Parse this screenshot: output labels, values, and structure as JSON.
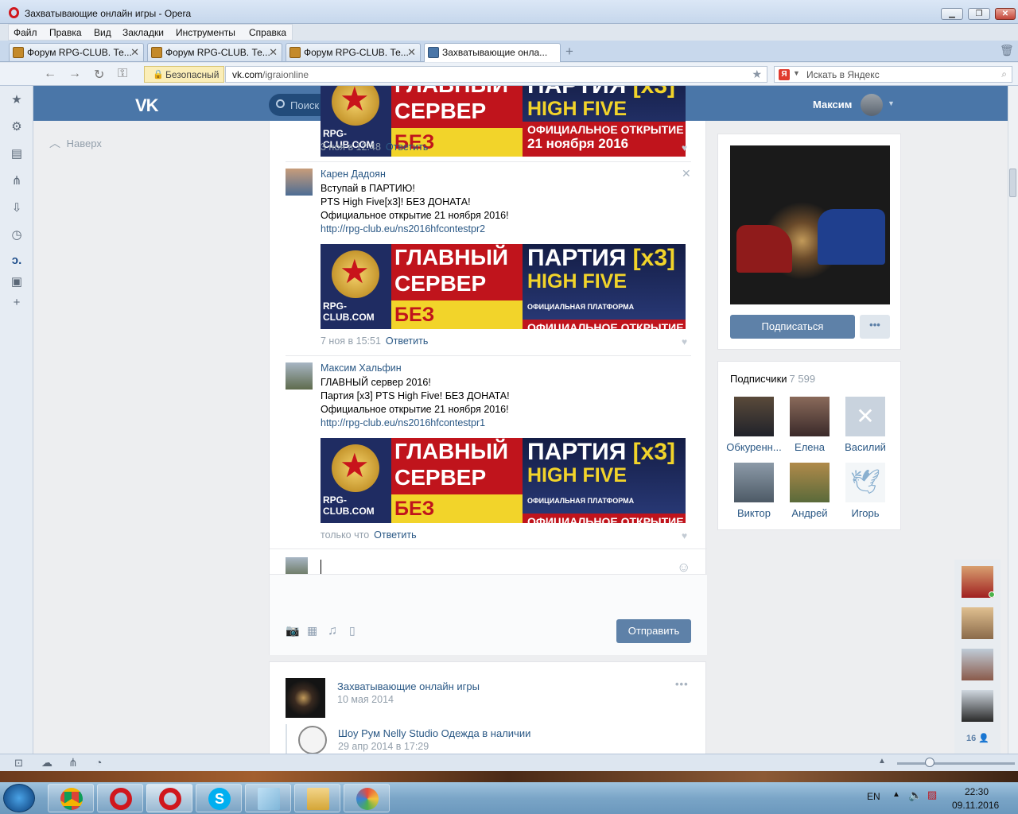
{
  "window": {
    "title": "Захватывающие онлайн игры - Opera"
  },
  "menu": [
    "Файл",
    "Правка",
    "Вид",
    "Закладки",
    "Инструменты",
    "Справка"
  ],
  "tabs": [
    {
      "label": "Форум RPG-CLUB. Те...",
      "active": false
    },
    {
      "label": "Форум RPG-CLUB. Те...",
      "active": false
    },
    {
      "label": "Форум RPG-CLUB. Те...",
      "active": false
    },
    {
      "label": "Захватывающие онла...",
      "active": true
    }
  ],
  "address": {
    "secure_label": "Безопасный",
    "url_host": "vk.com",
    "url_path": "/igraionline",
    "search_placeholder": "Искать в Яндекс"
  },
  "vk": {
    "search_placeholder": "Поиск",
    "user_name": "Максим",
    "scroll_up": "Наверх"
  },
  "banner": {
    "logo_text": "RPG-CLUB.COM",
    "line1": "ГЛАВНЫЙ",
    "line2": "СЕРВЕР",
    "line3": "БЕЗ ДОНАТА",
    "party": "ПАРТИЯ",
    "x3": "[x3]",
    "high_five": "HIGH FIVE",
    "official_platform": "ОФИЦИАЛЬНАЯ ПЛАТФОРМА",
    "opening": "ОФИЦИАЛЬНОЕ ОТКРЫТИЕ",
    "date": "21 ноября 2016"
  },
  "comments": [
    {
      "meta": "3 ноя в 12:48",
      "reply": "Ответить"
    },
    {
      "author": "Карен Дадоян",
      "lines": [
        "Вступай в ПАРТИЮ!",
        "PTS High Five[x3]! БЕЗ ДОНАТА!",
        "Официальное открытие 21 ноября 2016!"
      ],
      "link": "http://rpg-club.eu/ns2016hfcontestpr2",
      "meta": "7 ноя в 15:51",
      "reply": "Ответить"
    },
    {
      "author": "Максим Хальфин",
      "lines": [
        "ГЛАВНЫЙ сервер 2016!",
        "Партия [x3] PTS High Five! БЕЗ ДОНАТА!",
        "Официальное открытие 21 ноября 2016!"
      ],
      "link": "http://rpg-club.eu/ns2016hfcontestpr1",
      "meta": "только что",
      "reply": "Ответить"
    }
  ],
  "composer": {
    "send_label": "Отправить"
  },
  "next_post": {
    "group_name": "Захватывающие онлайн игры",
    "date": "10 мая 2014",
    "shared_title": "Шоу Рум Nelly Studio Одежда в наличии",
    "shared_date": "29 апр 2014 в 17:29"
  },
  "profile": {
    "subscribe_label": "Подписаться",
    "more_label": "•••"
  },
  "followers": {
    "title": "Подписчики",
    "count": "7 599",
    "people": [
      "Обкуренн...",
      "Елена",
      "Василий",
      "Виктор",
      "Андрей",
      "Игорь"
    ]
  },
  "chat": {
    "online_count": "16"
  },
  "tray": {
    "lang": "EN",
    "time": "22:30",
    "date": "09.11.2016"
  },
  "colors": {
    "vk_blue": "#4a76a8",
    "link": "#2a5885",
    "button": "#5e81a8",
    "meta": "#939fab"
  }
}
